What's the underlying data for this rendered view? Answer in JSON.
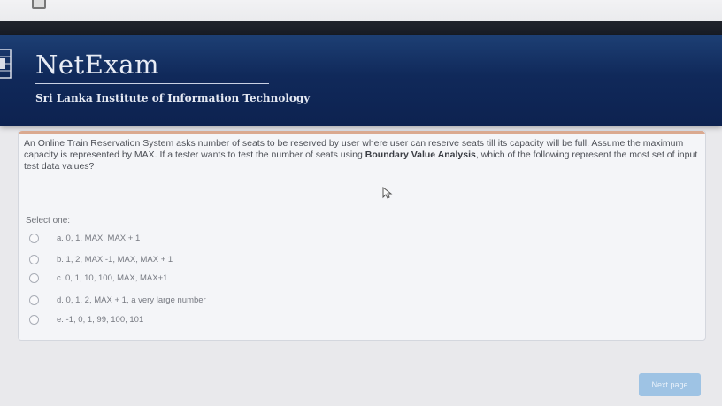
{
  "header": {
    "title": "NetExam",
    "subtitle": "Sri Lanka Institute of Information Technology"
  },
  "quiz": {
    "question_part1": "An Online Train Reservation System asks number of seats to be reserved by user where user can reserve seats till its capacity will be full. Assume the maximum capacity is represented by MAX. If a tester wants to test the number of seats using ",
    "question_bold": "Boundary Value Analysis",
    "question_part2": ", which of the following represent the most set of input test data values?",
    "select_label": "Select one:",
    "options": [
      {
        "label": "a. 0, 1, MAX, MAX + 1"
      },
      {
        "label": "b. 1, 2, MAX -1, MAX, MAX + 1"
      },
      {
        "label": "c. 0, 1, 10, 100, MAX, MAX+1"
      },
      {
        "label": "d. 0, 1, 2, MAX + 1, a very large number"
      },
      {
        "label": "e. -1, 0, 1, 99, 100, 101"
      }
    ]
  },
  "navigation": {
    "next_label": "Next page"
  },
  "colors": {
    "header_bg": "#10295a",
    "accent_strip": "#c46a3b",
    "button_bg": "#9ec3e4"
  }
}
